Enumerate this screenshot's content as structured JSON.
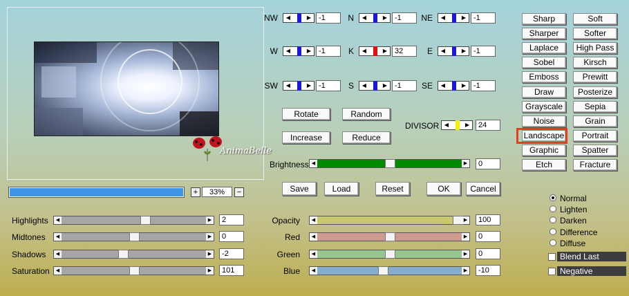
{
  "preview": {
    "watermark": "AnimaBelle"
  },
  "progress": {
    "fraction": 1.0
  },
  "zoom": {
    "plus": "+",
    "value": "33%",
    "minus": "−"
  },
  "directions": [
    {
      "label": "NW",
      "value": "-1",
      "marker": "#1a1ad6"
    },
    {
      "label": "N",
      "value": "-1",
      "marker": "#1a1ad6"
    },
    {
      "label": "NE",
      "value": "-1",
      "marker": "#1a1ad6"
    },
    {
      "label": "W",
      "value": "-1",
      "marker": "#1a1ad6"
    },
    {
      "label": "K",
      "value": "32",
      "marker": "#e01010"
    },
    {
      "label": "E",
      "value": "-1",
      "marker": "#1a1ad6"
    },
    {
      "label": "SW",
      "value": "-1",
      "marker": "#1a1ad6"
    },
    {
      "label": "S",
      "value": "-1",
      "marker": "#1a1ad6"
    },
    {
      "label": "SE",
      "value": "-1",
      "marker": "#1a1ad6"
    }
  ],
  "divisor": {
    "label": "DIVISOR",
    "value": "24",
    "marker": "#f2f200"
  },
  "actions": {
    "rotate": "Rotate",
    "random": "Random",
    "increase": "Increase",
    "reduce": "Reduce"
  },
  "brightness": {
    "label": "Brightness",
    "value": "0",
    "fill": "#008a00",
    "level": 0.5
  },
  "bottom_buttons": {
    "save": "Save",
    "load": "Load",
    "reset": "Reset",
    "ok": "OK",
    "cancel": "Cancel"
  },
  "presets": [
    [
      "Sharp",
      "Soft"
    ],
    [
      "Sharper",
      "Softer"
    ],
    [
      "Laplace",
      "High Pass"
    ],
    [
      "Sobel",
      "Kirsch"
    ],
    [
      "Emboss",
      "Prewitt"
    ],
    [
      "Draw",
      "Posterize"
    ],
    [
      "Grayscale",
      "Sepia"
    ],
    [
      "Noise",
      "Grain"
    ],
    [
      "Landscape",
      "Portrait"
    ],
    [
      "Graphic",
      "Spatter"
    ],
    [
      "Etch",
      "Fracture"
    ]
  ],
  "selected_preset": "Landscape",
  "tone_sliders": [
    {
      "label": "Highlights",
      "value": "2",
      "level": 0.58
    },
    {
      "label": "Midtones",
      "value": "0",
      "level": 0.5
    },
    {
      "label": "Shadows",
      "value": "-2",
      "level": 0.42
    },
    {
      "label": "Saturation",
      "value": "101",
      "level": 0.5
    }
  ],
  "color_sliders": [
    {
      "label": "Opacity",
      "value": "100",
      "fill": "#c9c86a",
      "level": 1.0
    },
    {
      "label": "Red",
      "value": "0",
      "fill": "#cf9a92",
      "level": 0.5
    },
    {
      "label": "Green",
      "value": "0",
      "fill": "#98c690",
      "level": 0.5
    },
    {
      "label": "Blue",
      "value": "-10",
      "fill": "#86acce",
      "level": 0.45
    }
  ],
  "blend_modes": {
    "options": [
      "Normal",
      "Lighten",
      "Darken",
      "Difference",
      "Diffuse"
    ],
    "selected": "Normal"
  },
  "checkboxes": {
    "blend_last": "Blend Last",
    "negative": "Negative"
  }
}
